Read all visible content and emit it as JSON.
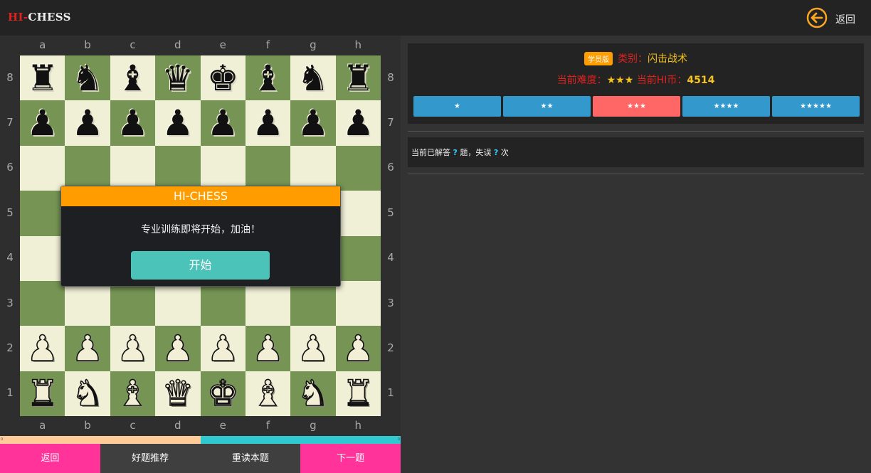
{
  "header": {
    "logo_red": "HI-",
    "logo_white": "CHESS",
    "back_label": "返回"
  },
  "board": {
    "files": [
      "a",
      "b",
      "c",
      "d",
      "e",
      "f",
      "g",
      "h"
    ],
    "ranks": [
      "8",
      "7",
      "6",
      "5",
      "4",
      "3",
      "2",
      "1"
    ],
    "rows": [
      [
        "br",
        "bn",
        "bb",
        "bq",
        "bk",
        "bb",
        "bn",
        "br"
      ],
      [
        "bp",
        "bp",
        "bp",
        "bp",
        "bp",
        "bp",
        "bp",
        "bp"
      ],
      [
        "",
        "",
        "",
        "",
        "",
        "",
        "",
        ""
      ],
      [
        "",
        "",
        "",
        "",
        "",
        "",
        "",
        ""
      ],
      [
        "",
        "",
        "",
        "",
        "",
        "",
        "",
        ""
      ],
      [
        "",
        "",
        "",
        "",
        "",
        "",
        "",
        ""
      ],
      [
        "wp",
        "wp",
        "wp",
        "wp",
        "wp",
        "wp",
        "wp",
        "wp"
      ],
      [
        "wr",
        "wn",
        "wb",
        "wq",
        "wk",
        "wb",
        "wn",
        "wr"
      ]
    ],
    "light_color": "#f0f0d7",
    "dark_color": "#769554"
  },
  "modal": {
    "title": "HI-CHESS",
    "message": "专业训练即将开始，加油！",
    "start_label": "开始"
  },
  "progress": {
    "left_value": "0",
    "right_value": "0",
    "left_fraction": 0.5
  },
  "bottom_buttons": [
    {
      "label": "返回",
      "style": "pink"
    },
    {
      "label": "好题推荐",
      "style": "grey"
    },
    {
      "label": "重读本题",
      "style": "grey"
    },
    {
      "label": "下一题",
      "style": "pink"
    }
  ],
  "info": {
    "badge": "学员版",
    "category_label": "类别：",
    "category_value": "闪击战术",
    "difficulty_label": "当前难度：",
    "difficulty_value": "★★★",
    "coin_label": "当前HI币：",
    "coin_value": "4514",
    "levels": [
      "★",
      "★★",
      "★★★",
      "★★★★",
      "★★★★★"
    ],
    "active_level": 2
  },
  "stats": {
    "prefix": "当前已解答",
    "solved": "?",
    "mid": "题，失误",
    "failed": "?",
    "suffix": "次"
  },
  "colors": {
    "accent": "#ff9d00",
    "pink": "#ff3399",
    "blue": "#3399cc",
    "teal": "#4cc3b9"
  }
}
